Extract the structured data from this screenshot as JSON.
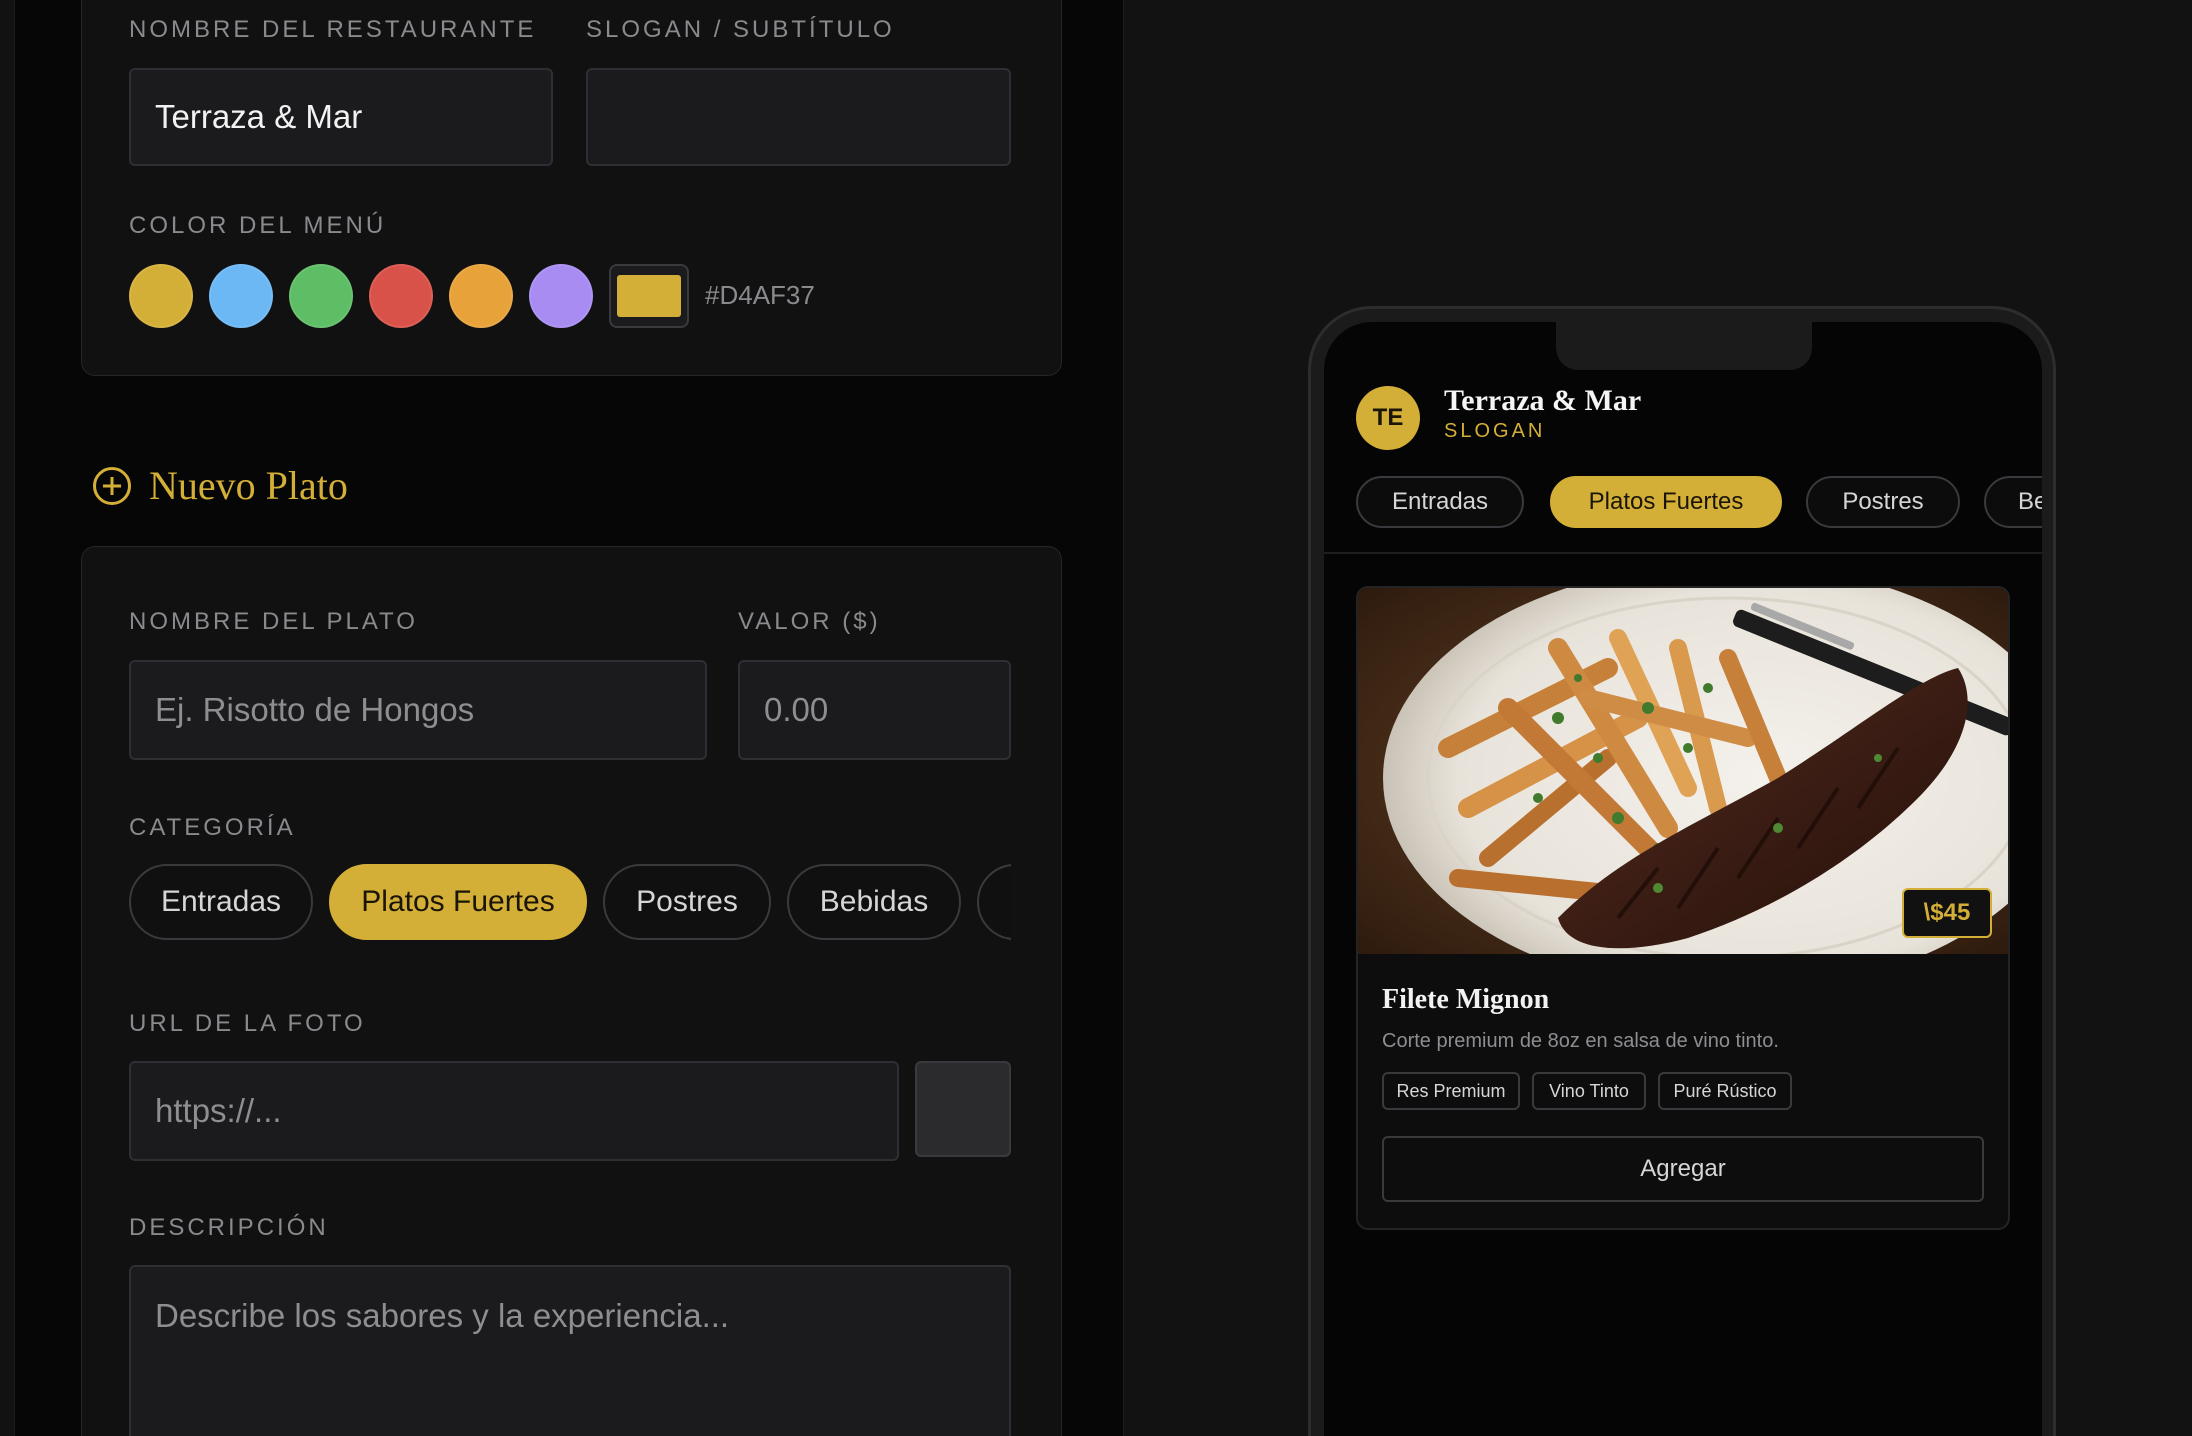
{
  "restaurant_settings": {
    "name_label": "NOMBRE DEL RESTAURANTE",
    "name_value": "Terraza & Mar",
    "slogan_label": "SLOGAN / SUBTÍTULO",
    "slogan_value": "",
    "color_label": "COLOR DEL MENÚ",
    "swatches": [
      "#D4AF37",
      "#6CB8F5",
      "#5EBE66",
      "#D9524A",
      "#E8A23A",
      "#A88CF2"
    ],
    "selected_color": "#D4AF37",
    "selected_color_label": "#D4AF37"
  },
  "new_dish": {
    "section_title": "Nuevo Plato",
    "name_label": "NOMBRE DEL PLATO",
    "name_placeholder": "Ej. Risotto de Hongos",
    "price_label": "VALOR ($)",
    "price_placeholder": "0.00",
    "category_label": "CATEGORÍA",
    "categories": [
      "Entradas",
      "Platos Fuertes",
      "Postres",
      "Bebidas"
    ],
    "selected_category": "Platos Fuertes",
    "photo_label": "URL DE LA FOTO",
    "photo_placeholder": "https://...",
    "description_label": "DESCRIPCIÓN",
    "description_placeholder": "Describe los sabores y la experiencia..."
  },
  "preview": {
    "avatar_initials": "TE",
    "restaurant_name": "Terraza & Mar",
    "slogan": "SLOGAN",
    "categories": [
      "Entradas",
      "Platos Fuertes",
      "Postres",
      "Be"
    ],
    "selected_category": "Platos Fuertes",
    "dish": {
      "price": "\\$45",
      "title": "Filete Mignon",
      "description": "Corte premium de 8oz en salsa de vino tinto.",
      "tags": [
        "Res Premium",
        "Vino Tinto",
        "Puré Rústico"
      ],
      "add_button": "Agregar"
    }
  },
  "colors": {
    "accent": "#D4AF37",
    "background": "#121212",
    "panel": "#060606",
    "card": "#111111"
  }
}
